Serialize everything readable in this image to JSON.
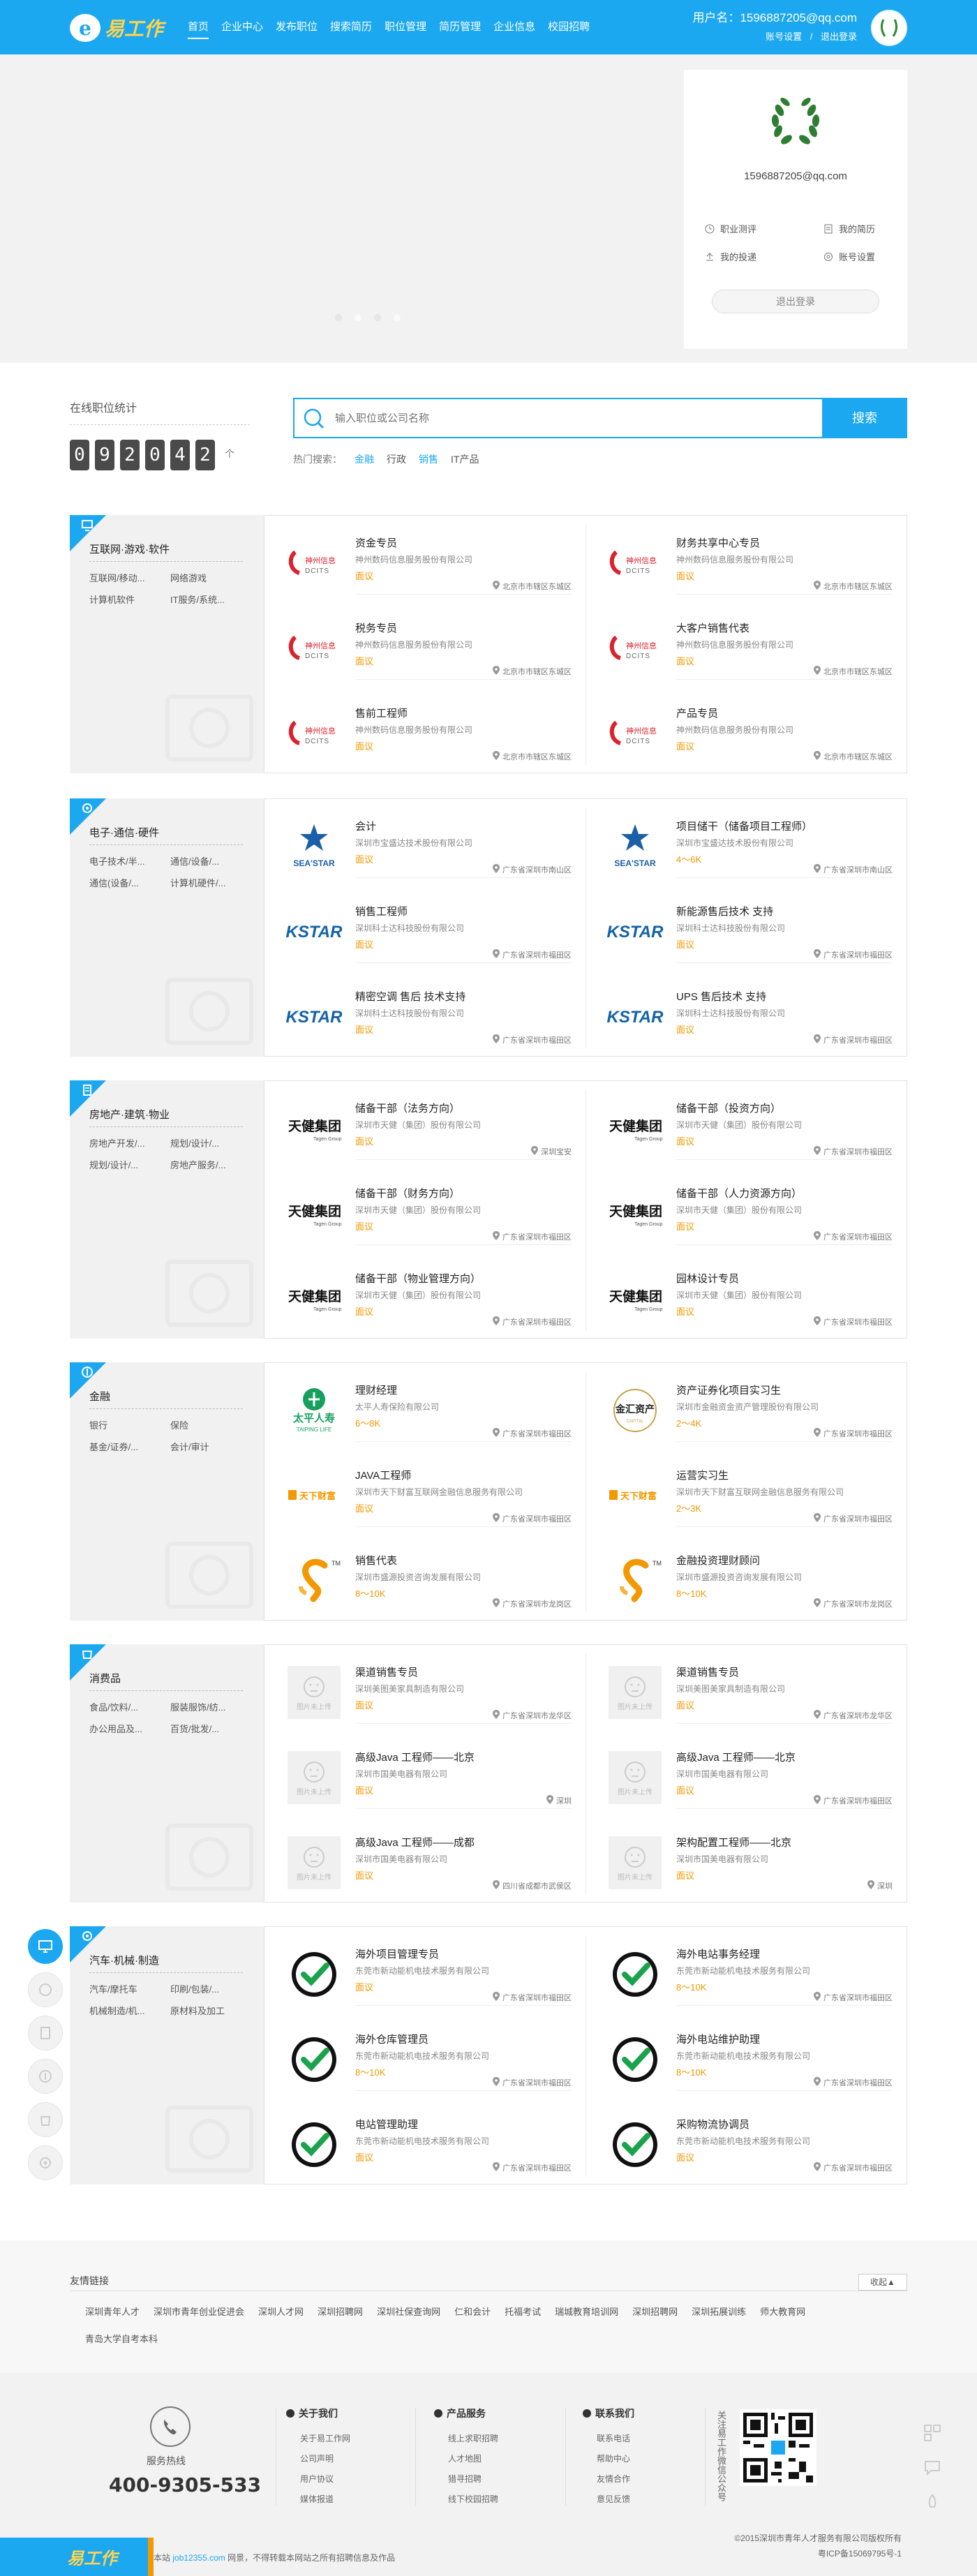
{
  "header": {
    "logo_text": "易工作",
    "nav": [
      "首页",
      "企业中心",
      "发布职位",
      "搜索简历",
      "职位管理",
      "简历管理",
      "企业信息",
      "校园招聘"
    ],
    "user_label": "用户名：",
    "username": "1596887205@qq.com",
    "account_settings": "账号设置",
    "separator": "/",
    "logout": "退出登录"
  },
  "profile": {
    "email": "1596887205@qq.com",
    "links": [
      "职业测评",
      "我的简历",
      "我的投递",
      "账号设置"
    ],
    "logout_button": "退出登录"
  },
  "stats": {
    "title": "在线职位统计",
    "digits": [
      "0",
      "9",
      "2",
      "0",
      "4",
      "2"
    ],
    "unit": "个"
  },
  "search": {
    "placeholder": "输入职位或公司名称",
    "button": "搜索",
    "hot_label": "热门搜索：",
    "hot_keywords": [
      "金融",
      "行政",
      "销售",
      "IT产品"
    ]
  },
  "sections": [
    {
      "title": "互联网·游戏·软件",
      "subcats": [
        "互联网/移动...",
        "网络游戏",
        "计算机软件",
        "IT服务/系统..."
      ],
      "jobs": [
        {
          "title": "资金专员",
          "company": "神州数码信息服务股份有限公司",
          "salary": "面议",
          "location": "北京市市辖区东城区",
          "logo": "DCITS"
        },
        {
          "title": "财务共享中心专员",
          "company": "神州数码信息服务股份有限公司",
          "salary": "面议",
          "location": "北京市市辖区东城区",
          "logo": "DCITS"
        },
        {
          "title": "税务专员",
          "company": "神州数码信息服务股份有限公司",
          "salary": "面议",
          "location": "北京市市辖区东城区",
          "logo": "DCITS"
        },
        {
          "title": "大客户销售代表",
          "company": "神州数码信息服务股份有限公司",
          "salary": "面议",
          "location": "北京市市辖区东城区",
          "logo": "DCITS"
        },
        {
          "title": "售前工程师",
          "company": "神州数码信息服务股份有限公司",
          "salary": "面议",
          "location": "北京市市辖区东城区",
          "logo": "DCITS"
        },
        {
          "title": "产品专员",
          "company": "神州数码信息服务股份有限公司",
          "salary": "面议",
          "location": "北京市市辖区东城区",
          "logo": "DCITS"
        }
      ]
    },
    {
      "title": "电子·通信·硬件",
      "subcats": [
        "电子技术/半...",
        "通信/设备/...",
        "通信(设备/...",
        "计算机硬件/..."
      ],
      "jobs": [
        {
          "title": "会计",
          "company": "深圳市宝盛达技术股份有限公司",
          "salary": "面议",
          "location": "广东省深圳市南山区",
          "logo": "SEA'STAR"
        },
        {
          "title": "项目储干（储备项目工程师）",
          "company": "深圳市宝盛达技术股份有限公司",
          "salary": "4～6K",
          "location": "广东省深圳市南山区",
          "logo": "SEA'STAR"
        },
        {
          "title": "销售工程师",
          "company": "深圳科士达科技股份有限公司",
          "salary": "面议",
          "location": "广东省深圳市福田区",
          "logo": "KSTAR"
        },
        {
          "title": "新能源售后技术 支持",
          "company": "深圳科士达科技股份有限公司",
          "salary": "面议",
          "location": "广东省深圳市福田区",
          "logo": "KSTAR"
        },
        {
          "title": "精密空调 售后 技术支持",
          "company": "深圳科士达科技股份有限公司",
          "salary": "面议",
          "location": "广东省深圳市福田区",
          "logo": "KSTAR"
        },
        {
          "title": "UPS 售后技术 支持",
          "company": "深圳科士达科技股份有限公司",
          "salary": "面议",
          "location": "广东省深圳市福田区",
          "logo": "KSTAR"
        }
      ]
    },
    {
      "title": "房地产·建筑·物业",
      "subcats": [
        "房地产开发/...",
        "规划/设计/...",
        "规划/设计/...",
        "房地产服务/..."
      ],
      "jobs": [
        {
          "title": "储备干部（法务方向）",
          "company": "深圳市天健（集团）股份有限公司",
          "salary": "面议",
          "location": "深圳宝安",
          "logo": "天健集团"
        },
        {
          "title": "储备干部（投资方向）",
          "company": "深圳市天健（集团）股份有限公司",
          "salary": "面议",
          "location": "广东省深圳市福田区",
          "logo": "天健集团"
        },
        {
          "title": "储备干部（财务方向）",
          "company": "深圳市天健（集团）股份有限公司",
          "salary": "面议",
          "location": "广东省深圳市福田区",
          "logo": "天健集团"
        },
        {
          "title": "储备干部（人力资源方向）",
          "company": "深圳市天健（集团）股份有限公司",
          "salary": "面议",
          "location": "广东省深圳市福田区",
          "logo": "天健集团"
        },
        {
          "title": "储备干部（物业管理方向）",
          "company": "深圳市天健（集团）股份有限公司",
          "salary": "面议",
          "location": "广东省深圳市福田区",
          "logo": "天健集团"
        },
        {
          "title": "园林设计专员",
          "company": "深圳市天健（集团）股份有限公司",
          "salary": "面议",
          "location": "广东省深圳市福田区",
          "logo": "天健集团"
        }
      ]
    },
    {
      "title": "金融",
      "subcats": [
        "银行",
        "保险",
        "基金/证券/...",
        "会计/审计"
      ],
      "jobs": [
        {
          "title": "理财经理",
          "company": "太平人寿保险有限公司",
          "salary": "6～8K",
          "location": "广东省深圳市福田区",
          "logo": "太平人寿"
        },
        {
          "title": "资产证券化项目实习生",
          "company": "深圳市金融资金资产管理股份有限公司",
          "salary": "2～4K",
          "location": "广东省深圳市福田区",
          "logo": "金汇资产"
        },
        {
          "title": "JAVA工程师",
          "company": "深圳市天下财富互联网金融信息服务有限公司",
          "salary": "面议",
          "location": "广东省深圳市福田区",
          "logo": "天下财富"
        },
        {
          "title": "运营实习生",
          "company": "深圳市天下财富互联网金融信息服务有限公司",
          "salary": "2～3K",
          "location": "广东省深圳市福田区",
          "logo": "天下财富"
        },
        {
          "title": "销售代表",
          "company": "深圳市盛源投资咨询发展有限公司",
          "salary": "8～10K",
          "location": "广东省深圳市龙岗区",
          "logo": "S"
        },
        {
          "title": "金融投资理财顾问",
          "company": "深圳市盛源投资咨询发展有限公司",
          "salary": "8～10K",
          "location": "广东省深圳市龙岗区",
          "logo": "S"
        }
      ]
    },
    {
      "title": "消费品",
      "subcats": [
        "食品/饮料/...",
        "服装服饰/纺...",
        "办公用品及...",
        "百货/批发/..."
      ],
      "jobs": [
        {
          "title": "渠道销售专员",
          "company": "深圳美图美家具制造有限公司",
          "salary": "面议",
          "location": "广东省深圳市龙华区",
          "logo": "图片未上传"
        },
        {
          "title": "渠道销售专员",
          "company": "深圳美图美家具制造有限公司",
          "salary": "面议",
          "location": "广东省深圳市龙华区",
          "logo": "图片未上传"
        },
        {
          "title": "高级Java 工程师——北京",
          "company": "深圳市国美电器有限公司",
          "salary": "面议",
          "location": "深圳",
          "logo": "图片未上传"
        },
        {
          "title": "高级Java 工程师——北京",
          "company": "深圳市国美电器有限公司",
          "salary": "面议",
          "location": "广东省深圳市福田区",
          "logo": "图片未上传"
        },
        {
          "title": "高级Java 工程师——成都",
          "company": "深圳市国美电器有限公司",
          "salary": "面议",
          "location": "四川省成都市武侯区",
          "logo": "图片未上传"
        },
        {
          "title": "架构配置工程师——北京",
          "company": "深圳市国美电器有限公司",
          "salary": "面议",
          "location": "深圳",
          "logo": "图片未上传"
        }
      ]
    },
    {
      "title": "汽车·机械·制造",
      "subcats": [
        "汽车/摩托车",
        "印刷/包装/...",
        "机械制造/机...",
        "原材料及加工"
      ],
      "jobs": [
        {
          "title": "海外项目管理专员",
          "company": "东莞市新动能机电技术服务有限公司",
          "salary": "面议",
          "location": "广东省深圳市福田区",
          "logo": "check"
        },
        {
          "title": "海外电站事务经理",
          "company": "东莞市新动能机电技术服务有限公司",
          "salary": "8～10K",
          "location": "广东省深圳市福田区",
          "logo": "check"
        },
        {
          "title": "海外仓库管理员",
          "company": "东莞市新动能机电技术服务有限公司",
          "salary": "8～10K",
          "location": "广东省深圳市福田区",
          "logo": "check"
        },
        {
          "title": "海外电站维护助理",
          "company": "东莞市新动能机电技术服务有限公司",
          "salary": "8～10K",
          "location": "广东省深圳市福田区",
          "logo": "check"
        },
        {
          "title": "电站管理助理",
          "company": "东莞市新动能机电技术服务有限公司",
          "salary": "面议",
          "location": "广东省深圳市福田区",
          "logo": "check"
        },
        {
          "title": "采购物流协调员",
          "company": "东莞市新动能机电技术服务有限公司",
          "salary": "面议",
          "location": "广东省深圳市福田区",
          "logo": "check"
        }
      ]
    }
  ],
  "friend_links": {
    "title": "友情链接",
    "fold_button": "收起▲",
    "links": [
      "深圳青年人才",
      "深圳市青年创业促进会",
      "深圳人才网",
      "深圳招聘网",
      "深圳社保查询网",
      "仁和会计",
      "托福考试",
      "瑞城教育培训网",
      "深圳招聘网",
      "深圳拓展训练",
      "师大教育网",
      "青岛大学自考本科"
    ]
  },
  "footer": {
    "hotline_label": "服务热线",
    "hotline": "400-9305-533",
    "columns": [
      {
        "title": "关于我们",
        "items": [
          "关于易工作网",
          "公司声明",
          "用户协议",
          "媒体报道"
        ]
      },
      {
        "title": "产品服务",
        "items": [
          "线上求职招聘",
          "人才地图",
          "猎寻招聘",
          "线下校园招聘"
        ]
      },
      {
        "title": "联系我们",
        "items": [
          "联系电话",
          "帮助中心",
          "友情合作",
          "意见反馈"
        ]
      }
    ],
    "follow_text": "关注易工作微信公众号",
    "copyright_lines": [
      "©2015深圳市青年人才服务有限公司版权所有",
      "粤ICP备15069795号-1"
    ],
    "notice_prefix": "本站",
    "notice_site": "job12355.com",
    "notice_suffix": "网景，不得转载本网站之所有招聘信息及作品",
    "bottom_logo": "易工作"
  },
  "colors": {
    "primary": "#1ba8f0",
    "salary": "#f39800",
    "logo_yellow": "#ffd34e"
  }
}
